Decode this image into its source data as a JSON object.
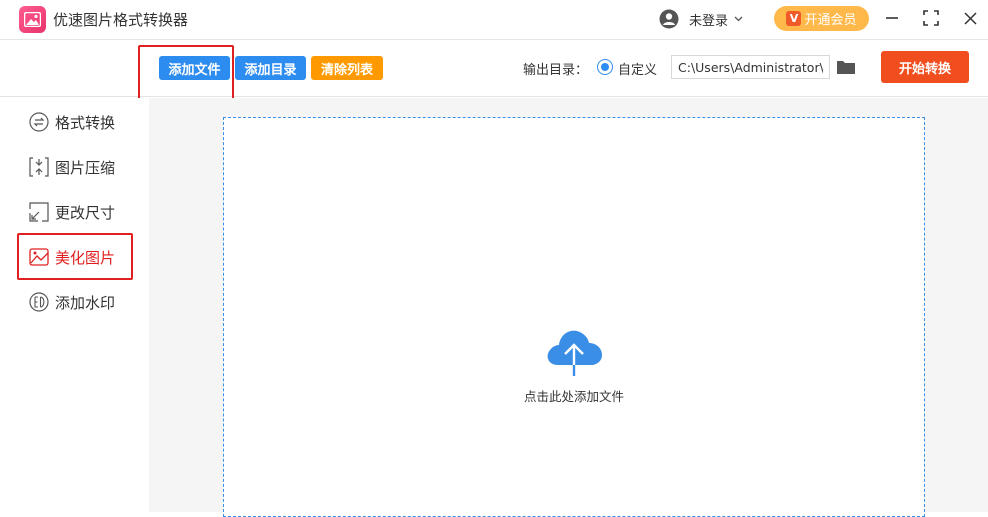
{
  "app": {
    "title": "优速图片格式转换器"
  },
  "header": {
    "login_label": "未登录",
    "vip_label": "开通会员",
    "vip_badge": "V"
  },
  "toolbar": {
    "add_file": "添加文件",
    "add_dir": "添加目录",
    "clear_list": "清除列表",
    "output_label": "输出目录：",
    "custom_label": "自定义",
    "output_path": "C:\\Users\\Administrator\\",
    "start_label": "开始转换"
  },
  "sidebar": {
    "items": [
      {
        "label": "格式转换",
        "icon": "format-convert-icon"
      },
      {
        "label": "图片压缩",
        "icon": "compress-icon"
      },
      {
        "label": "更改尺寸",
        "icon": "resize-icon"
      },
      {
        "label": "美化图片",
        "icon": "beautify-icon",
        "active": true
      },
      {
        "label": "添加水印",
        "icon": "watermark-icon"
      }
    ]
  },
  "dropzone": {
    "hint": "点击此处添加文件"
  },
  "colors": {
    "accent_blue": "#2d8cf0",
    "accent_orange": "#ff9900",
    "start_red": "#f04e1e",
    "highlight_red": "#e02020"
  }
}
